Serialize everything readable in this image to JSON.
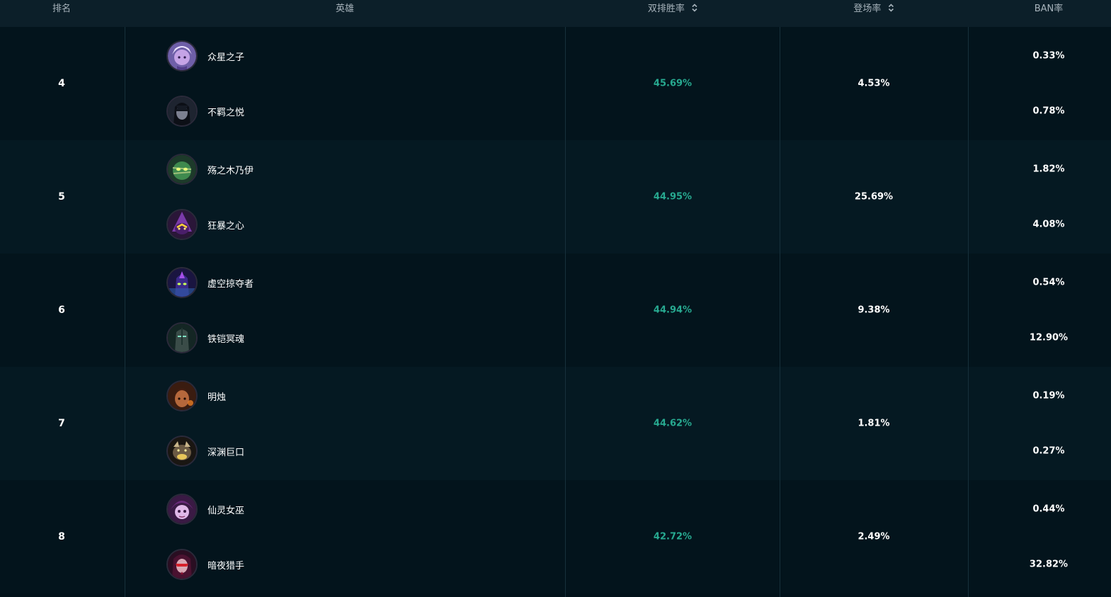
{
  "header": {
    "rank_label": "排名",
    "hero_label": "英雄",
    "winrate_label": "双排胜率",
    "pickrate_label": "登场率",
    "banrate_label": "BAN率"
  },
  "colors": {
    "winrate": "#27a990",
    "background": "#02121a",
    "header_bg": "#0c1f29"
  },
  "rows": [
    {
      "rank": "4",
      "winrate": "45.69%",
      "pickrate": "4.53%",
      "heroes": [
        {
          "name": "众星之子",
          "ban": "0.33%",
          "icon": "soraka-avatar"
        },
        {
          "name": "不羁之悦",
          "ban": "0.78%",
          "icon": "nilah-avatar"
        }
      ]
    },
    {
      "rank": "5",
      "winrate": "44.95%",
      "pickrate": "25.69%",
      "heroes": [
        {
          "name": "殇之木乃伊",
          "ban": "1.82%",
          "icon": "amumu-avatar"
        },
        {
          "name": "狂暴之心",
          "ban": "4.08%",
          "icon": "kennen-avatar"
        }
      ]
    },
    {
      "rank": "6",
      "winrate": "44.94%",
      "pickrate": "9.38%",
      "heroes": [
        {
          "name": "虚空掠夺者",
          "ban": "0.54%",
          "icon": "khazix-avatar"
        },
        {
          "name": "铁铠冥魂",
          "ban": "12.90%",
          "icon": "mordekaiser-avatar"
        }
      ]
    },
    {
      "rank": "7",
      "winrate": "44.62%",
      "pickrate": "1.81%",
      "heroes": [
        {
          "name": "明烛",
          "ban": "0.19%",
          "icon": "milio-avatar"
        },
        {
          "name": "深渊巨口",
          "ban": "0.27%",
          "icon": "kogmaw-avatar"
        }
      ]
    },
    {
      "rank": "8",
      "winrate": "42.72%",
      "pickrate": "2.49%",
      "heroes": [
        {
          "name": "仙灵女巫",
          "ban": "0.44%",
          "icon": "lulu-avatar"
        },
        {
          "name": "暗夜猎手",
          "ban": "32.82%",
          "icon": "vayne-avatar"
        }
      ]
    }
  ]
}
